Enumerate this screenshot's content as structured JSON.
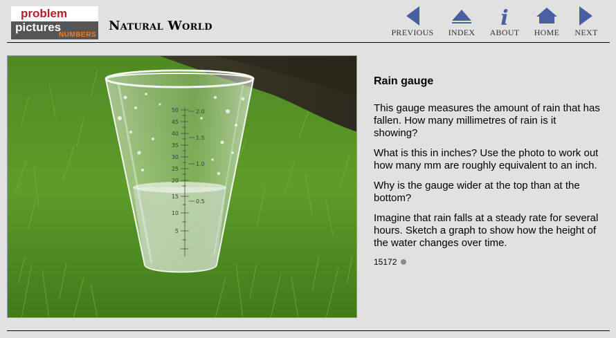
{
  "logo": {
    "line1": "problem",
    "line2": "pictures",
    "line3": "NUMBERS"
  },
  "header": {
    "section_title": "Natural World"
  },
  "nav": {
    "previous": {
      "label": "PREVIOUS",
      "icon": "arrow-left-icon"
    },
    "index": {
      "label": "INDEX",
      "icon": "triangle-up-icon"
    },
    "about": {
      "label": "ABOUT",
      "icon": "info-icon"
    },
    "home": {
      "label": "HOME",
      "icon": "home-icon"
    },
    "next": {
      "label": "NEXT",
      "icon": "arrow-right-icon"
    }
  },
  "colors": {
    "nav_icon": "#4a5fa3",
    "logo_red": "#b3202a",
    "logo_orange": "#f07d22",
    "background": "#e1e1e1"
  },
  "photo": {
    "mm_scale": [
      "50",
      "45",
      "40",
      "35",
      "30",
      "25",
      "20",
      "15",
      "10",
      "5"
    ],
    "inch_scale": [
      "2.0",
      "1.5",
      "1.0",
      "0.5"
    ]
  },
  "content": {
    "title": "Rain gauge",
    "paragraphs": [
      "This gauge measures the amount of rain that has fallen. How many millimetres of rain is it showing?",
      "What is this in inches? Use the photo to work out how many mm are roughly equivalent to an inch.",
      "Why is the gauge wider at the top than at the bottom?",
      "Imagine that rain falls at a steady rate for several hours. Sketch a graph to show how the height of the water changes over time."
    ],
    "id": "15172"
  }
}
